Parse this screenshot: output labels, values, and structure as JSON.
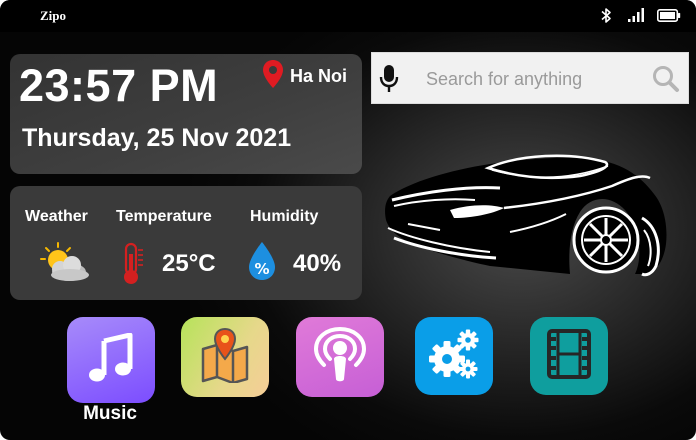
{
  "status_bar": {
    "title": "Zipo",
    "icons": [
      "bluetooth-icon",
      "signal-icon",
      "battery-icon"
    ]
  },
  "clock": {
    "time": "23:57 PM",
    "date": "Thursday, 25 Nov 2021",
    "location": "Ha Noi",
    "location_icon": "map-pin-icon"
  },
  "weather": {
    "weather_label": "Weather",
    "weather_icon": "partly-cloudy-icon",
    "temperature_label": "Temperature",
    "temperature_value": "25°C",
    "temperature_icon": "thermometer-icon",
    "humidity_label": "Humidity",
    "humidity_value": "40%",
    "humidity_icon": "water-drop-icon"
  },
  "search": {
    "placeholder": "Search for anything",
    "value": "",
    "mic_icon": "microphone-icon",
    "search_icon": "search-icon"
  },
  "dock": {
    "apps": [
      {
        "name": "music",
        "label": "Music",
        "icon": "music-note-icon",
        "color": "#8b5cf6"
      },
      {
        "name": "maps",
        "label": "",
        "icon": "map-icon",
        "color": "#c6e06a"
      },
      {
        "name": "podcasts",
        "label": "",
        "icon": "podcast-icon",
        "color": "#d16bd8"
      },
      {
        "name": "settings",
        "label": "",
        "icon": "gears-icon",
        "color": "#0a9ee8"
      },
      {
        "name": "video",
        "label": "",
        "icon": "film-icon",
        "color": "#0f9e9e"
      }
    ]
  },
  "colors": {
    "pin_red": "#e01b22",
    "thermometer_red": "#d42020",
    "drop_blue": "#1d8fe0"
  }
}
